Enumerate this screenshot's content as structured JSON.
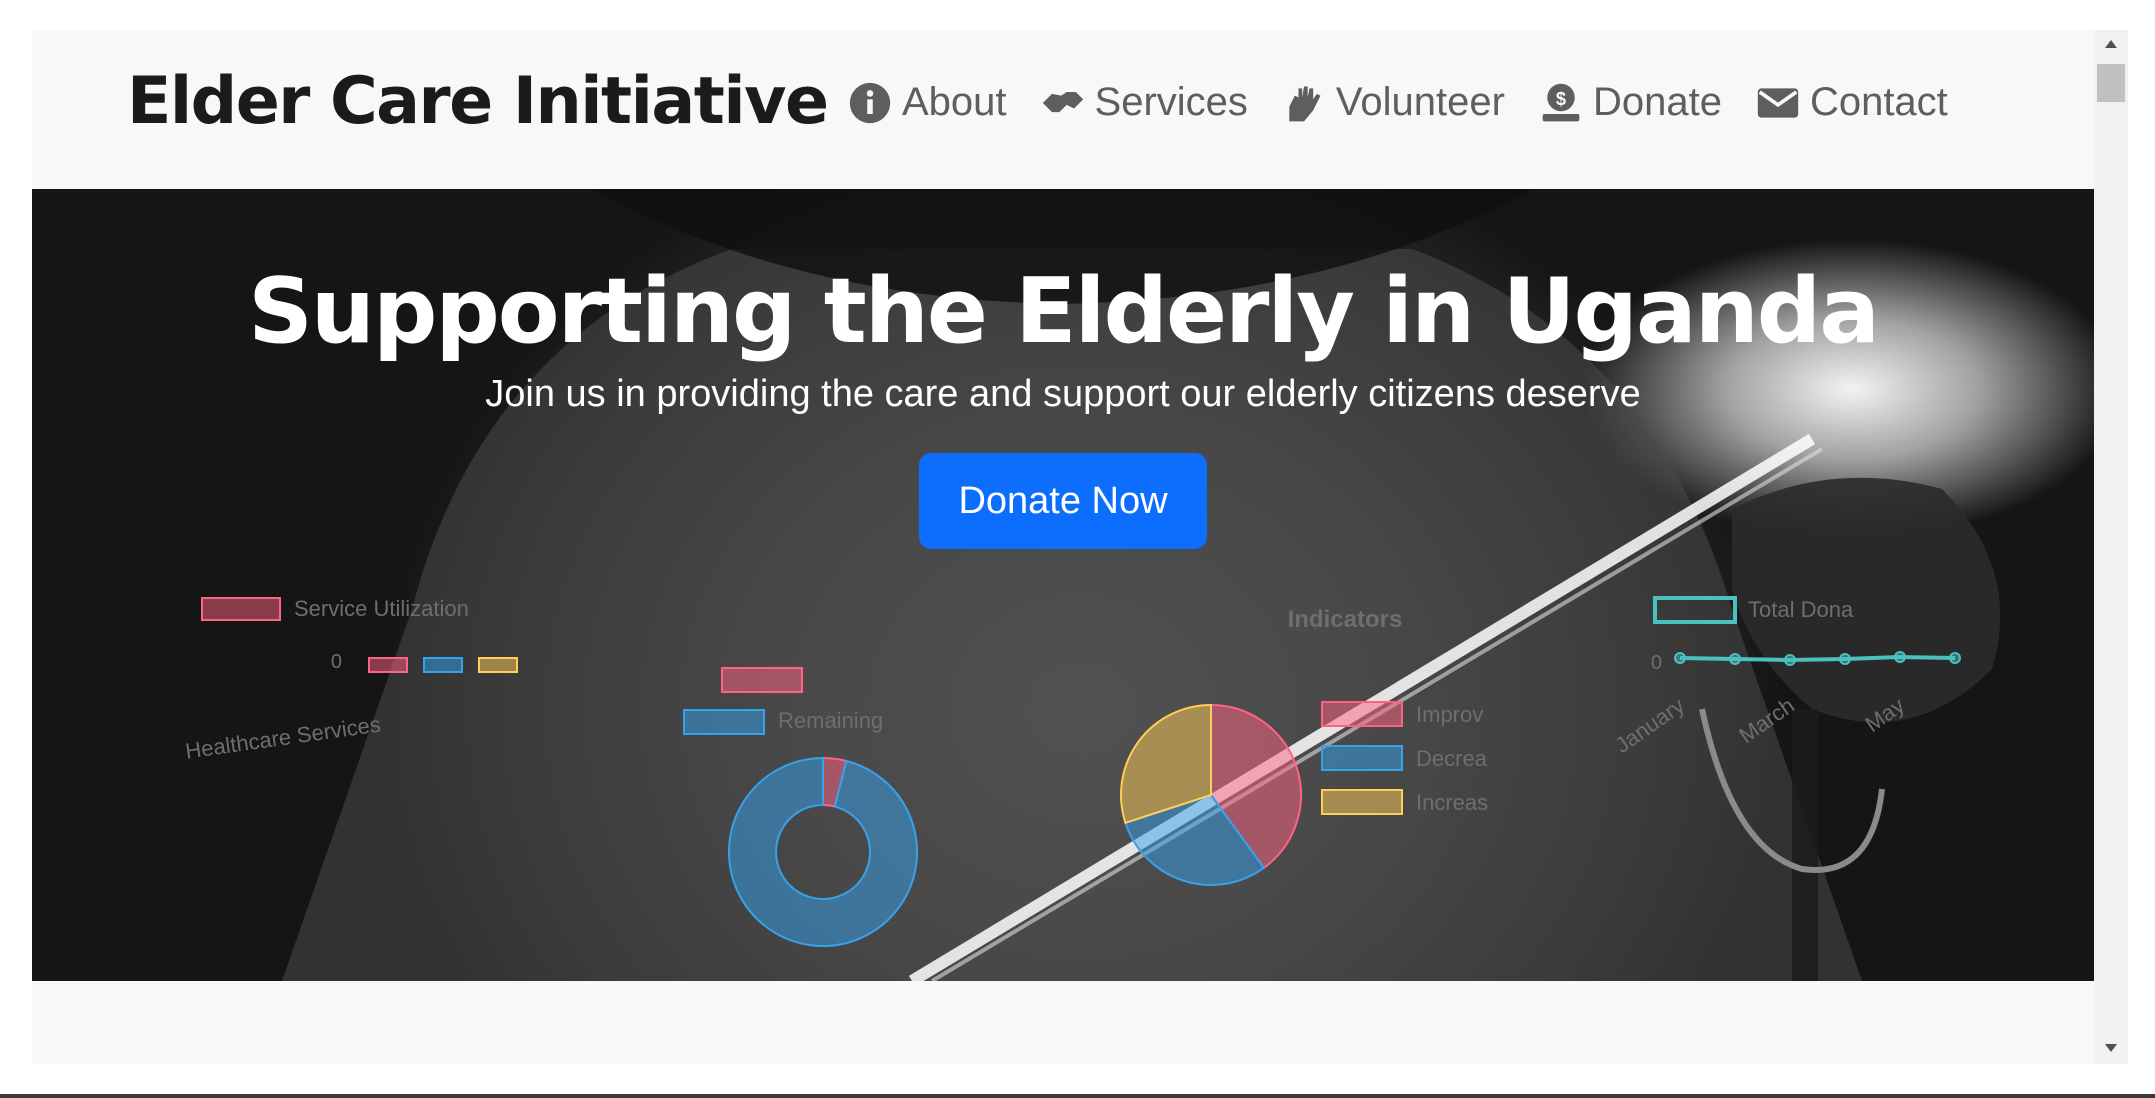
{
  "brand": {
    "name": "Elder Care Initiative"
  },
  "nav": {
    "items": [
      {
        "label": "About",
        "icon": "info-circle-icon"
      },
      {
        "label": "Services",
        "icon": "handshake-icon"
      },
      {
        "label": "Volunteer",
        "icon": "hands-helping-icon"
      },
      {
        "label": "Donate",
        "icon": "donate-icon"
      },
      {
        "label": "Contact",
        "icon": "envelope-icon"
      }
    ]
  },
  "hero": {
    "title": "Supporting the Elderly in Uganda",
    "subtitle": "Join us in providing the care and support our elderly citizens deserve",
    "cta_label": "Donate Now"
  },
  "colors": {
    "primary": "#0d6efd",
    "red": "#ff6384",
    "blue": "#36a2eb",
    "yellow": "#ffce56",
    "teal": "#4bc0c0"
  },
  "chart_data": [
    {
      "type": "bar",
      "legend": [
        "Service Utilization"
      ],
      "ytick": "0",
      "categories": [
        "Healthcare Services"
      ],
      "series": [
        {
          "name": "Service Utilization",
          "values": [
            0,
            0,
            0
          ]
        }
      ]
    },
    {
      "type": "pie",
      "variant": "doughnut",
      "legend": [
        "",
        "Remaining"
      ],
      "slices": [
        {
          "label": "",
          "value": 4
        },
        {
          "label": "Remaining",
          "value": 96
        }
      ]
    },
    {
      "type": "pie",
      "title": "Indicators",
      "legend": [
        "Improv",
        "Decrea",
        "Increas"
      ],
      "slices": [
        {
          "label": "Improv",
          "value": 40
        },
        {
          "label": "Decrea",
          "value": 30
        },
        {
          "label": "Increas",
          "value": 30
        }
      ]
    },
    {
      "type": "line",
      "legend": [
        "Total Dona"
      ],
      "ytick": "0",
      "x": [
        "January",
        "",
        "March",
        "",
        "May",
        ""
      ],
      "series": [
        {
          "name": "Total Dona",
          "values": [
            0,
            0,
            0,
            0,
            0,
            0
          ]
        }
      ]
    }
  ]
}
